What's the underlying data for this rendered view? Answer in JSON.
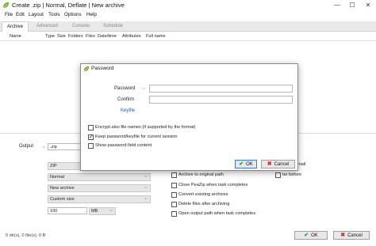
{
  "window": {
    "title": "Create .zip | Normal, Deflate | New archive",
    "controls": [
      "—",
      "☐",
      "✕"
    ]
  },
  "menu": [
    "File",
    "Edit",
    "Layout",
    "Tools",
    "Options",
    "Help"
  ],
  "tabs": [
    "Archive",
    "Advanced",
    "Console",
    "Schedule"
  ],
  "columns": [
    "Name",
    "Type",
    "Size",
    "Folders",
    "Files",
    "Date/time",
    "Attributes",
    "Full name"
  ],
  "output": {
    "label": "Output",
    "format_value": ".zip"
  },
  "options_left": {
    "format": "ZIP",
    "level": "Normal",
    "mode": "New archive",
    "volume": "Custom size",
    "size_value": "100",
    "size_unit": "MB"
  },
  "options_right": {
    "partial_top": "mail",
    "partial_right": "tar before",
    "checks": [
      {
        "label": "Archive to original path",
        "checked": false
      },
      {
        "label": "Close PeaZip when task completes",
        "checked": false
      },
      {
        "label": "Convert existing archives",
        "checked": false
      },
      {
        "label": "Delete files after archiving",
        "checked": false
      },
      {
        "label": "Open output path when task completes",
        "checked": false
      }
    ]
  },
  "main_buttons": {
    "ok": "OK",
    "cancel": "Cancel"
  },
  "status_text": "0 dir(s), 0 file(s), 0 B",
  "dialog": {
    "title": "Password",
    "password_label": "Password",
    "password_value": "",
    "confirm_label": "Confirm",
    "confirm_value": "",
    "keyfile_label": "Keyfile",
    "checks": [
      {
        "label": "Encrypt also file names (if supported by the format)",
        "checked": false
      },
      {
        "label": "Keep password/keyfile for current session",
        "checked": true
      },
      {
        "label": "Show password field content",
        "checked": false
      }
    ],
    "ok": "OK",
    "cancel": "Cancel"
  },
  "colors": {
    "accent": "#3b7bd4",
    "ok": "#2e9e2e",
    "cancel": "#d03030",
    "leaf": "#6aa51e"
  }
}
